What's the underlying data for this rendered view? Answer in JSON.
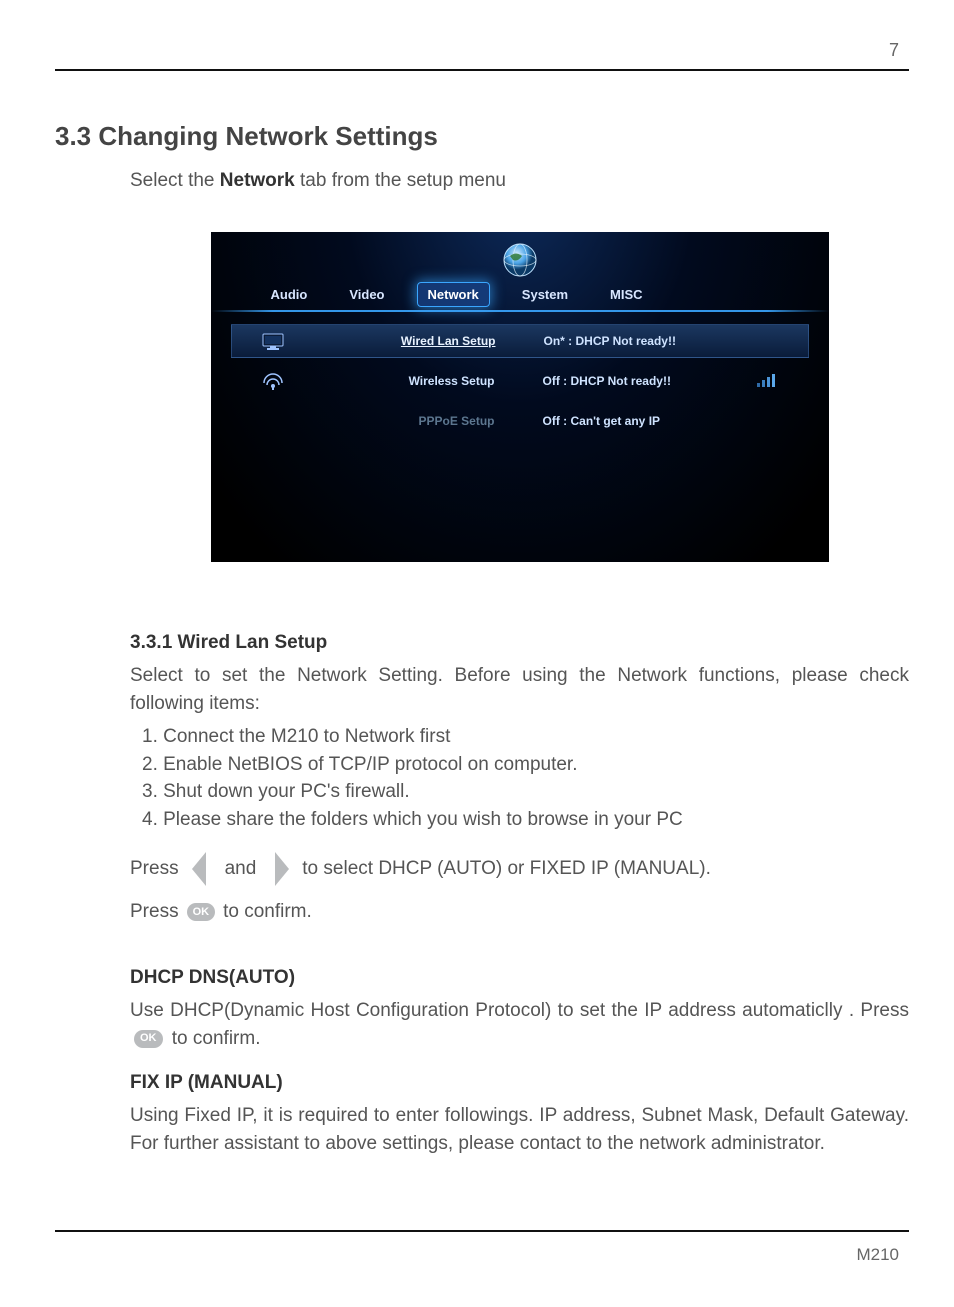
{
  "page": {
    "number": "7",
    "footer_model": "M210"
  },
  "section": {
    "title": "3.3 Changing Network Settings"
  },
  "intro": {
    "prefix": "Select the ",
    "bold": "Network",
    "suffix": " tab from the setup menu"
  },
  "screenshot": {
    "tabs": {
      "audio": "Audio",
      "video": "Video",
      "network": "Network",
      "system": "System",
      "misc": "MISC"
    },
    "rows": {
      "wired": {
        "label": "Wired Lan Setup",
        "status": "On* : DHCP Not ready!!"
      },
      "wireless": {
        "label": "Wireless Setup",
        "status": "Off : DHCP Not ready!!"
      },
      "pppoe": {
        "label": "PPPoE Setup",
        "status": "Off : Can't get any IP"
      }
    }
  },
  "wired": {
    "title": "3.3.1 Wired Lan Setup",
    "intro": "Select to set the Network Setting. Before using the Network functions, please check following items:",
    "items": {
      "i1": "1. Connect the M210 to Network first",
      "i2": "2. Enable NetBIOS of TCP/IP protocol on computer.",
      "i3": "3. Shut down your PC's firewall.",
      "i4": "4. Please share the folders which you wish to browse in your PC"
    },
    "press1": {
      "a": "Press",
      "b": "and",
      "c": "to select DHCP (AUTO) or FIXED IP (MANUAL)."
    },
    "press2": {
      "a": "Press",
      "b": "to confirm."
    }
  },
  "dhcp": {
    "title": "DHCP DNS(AUTO)",
    "body": "Use DHCP(Dynamic Host Configuration Protocol) to set the IP address automaticlly . Press",
    "confirm": "to confirm."
  },
  "fixip": {
    "title": "FIX IP (MANUAL)",
    "body": "Using Fixed IP, it is required to enter followings. IP address, Subnet Mask, Default Gateway. For further assistant to above settings, please contact to the network administrator."
  },
  "buttons": {
    "ok": "OK"
  }
}
